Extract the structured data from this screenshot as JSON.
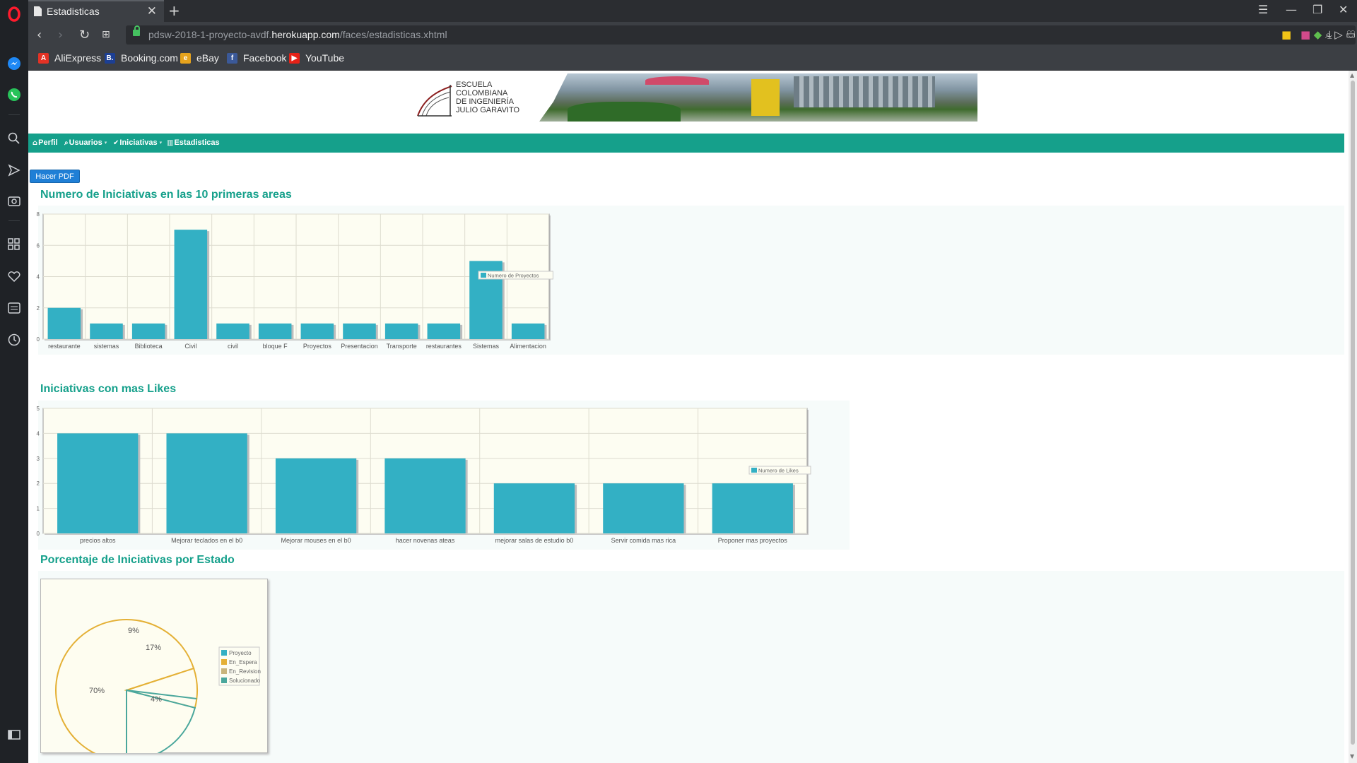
{
  "browser": {
    "tab_title": "Estadisticas",
    "url_prefix": "pdsw-2018-1-proyecto-avdf.",
    "url_domain": "herokuapp.com",
    "url_path": "/faces/estadisticas.xhtml",
    "bookmarks": [
      {
        "label": "AliExpress",
        "color": "#e43225"
      },
      {
        "label": "Booking.com",
        "color": "#1c3f94"
      },
      {
        "label": "eBay",
        "color": "#e6a31d"
      },
      {
        "label": "Facebook",
        "color": "#3b5998"
      },
      {
        "label": "YouTube",
        "color": "#e62117"
      }
    ]
  },
  "banner": {
    "logo_lines": [
      "ESCUELA",
      "COLOMBIANA",
      "DE INGENIERÍA",
      "JULIO GARAVITO"
    ]
  },
  "nav": {
    "items": [
      {
        "label": "Perfil",
        "icon": "home-icon"
      },
      {
        "label": "Usuarios",
        "icon": "search-icon"
      },
      {
        "label": "Iniciativas",
        "icon": "check-icon"
      },
      {
        "label": "Estadisticas",
        "icon": "bar-chart-icon"
      }
    ]
  },
  "pdf_button": "Hacer PDF",
  "sections": {
    "areas_title": "Numero de Iniciativas en las 10 primeras areas",
    "likes_title": "Iniciativas con mas Likes",
    "estado_title": "Porcentaje de Iniciativas por Estado"
  },
  "colors": {
    "accent": "#15a08b",
    "bar": "#33b0c4",
    "pie_line": "#e4b035",
    "pie_line2": "#4aa79c",
    "plot_bg": "#fdfdf2"
  },
  "chart_data": [
    {
      "type": "bar",
      "title": "Numero de Iniciativas en las 10 primeras areas",
      "categories": [
        "restaurante",
        "sistemas",
        "Biblioteca",
        "Civil",
        "civil",
        "bloque F",
        "Proyectos",
        "Presentacion",
        "Transporte",
        "restaurantes",
        "Sistemas",
        "Alimentacion"
      ],
      "series": [
        {
          "name": "Numero de Proyectos",
          "values": [
            2,
            1,
            1,
            7,
            1,
            1,
            1,
            1,
            1,
            1,
            5,
            1
          ]
        }
      ],
      "ylim": [
        0,
        8
      ],
      "yticks": [
        0,
        2,
        4,
        6,
        8
      ],
      "grid": true,
      "legend": "right"
    },
    {
      "type": "bar",
      "title": "Iniciativas con mas Likes",
      "categories": [
        "precios altos",
        "Mejorar teclados en el b0",
        "Mejorar mouses en el b0",
        "hacer novenas ateas",
        "mejorar salas de estudio b0",
        "Servir comida mas rica",
        "Proponer mas proyectos"
      ],
      "series": [
        {
          "name": "Numero de Likes",
          "values": [
            4,
            4,
            3,
            3,
            2,
            2,
            2
          ]
        }
      ],
      "ylim": [
        0,
        5
      ],
      "yticks": [
        0,
        1,
        2,
        3,
        4,
        5
      ],
      "grid": true,
      "legend": "right"
    },
    {
      "type": "pie",
      "title": "Porcentaje de Iniciativas por Estado",
      "categories": [
        "Proyecto",
        "En_Espera",
        "En_Revision",
        "Solucionado"
      ],
      "values": [
        0,
        70,
        9,
        21
      ],
      "slice_labels": [
        {
          "text": "70%",
          "slice": 1
        },
        {
          "text": "9%",
          "slice": 2
        },
        {
          "text": "17%",
          "slice": 3
        },
        {
          "text": "4%",
          "slice": 3
        }
      ],
      "legend_colors": [
        "#33b0c4",
        "#e4b035",
        "#c9b57b",
        "#4aa79c"
      ],
      "legend": "right"
    }
  ]
}
